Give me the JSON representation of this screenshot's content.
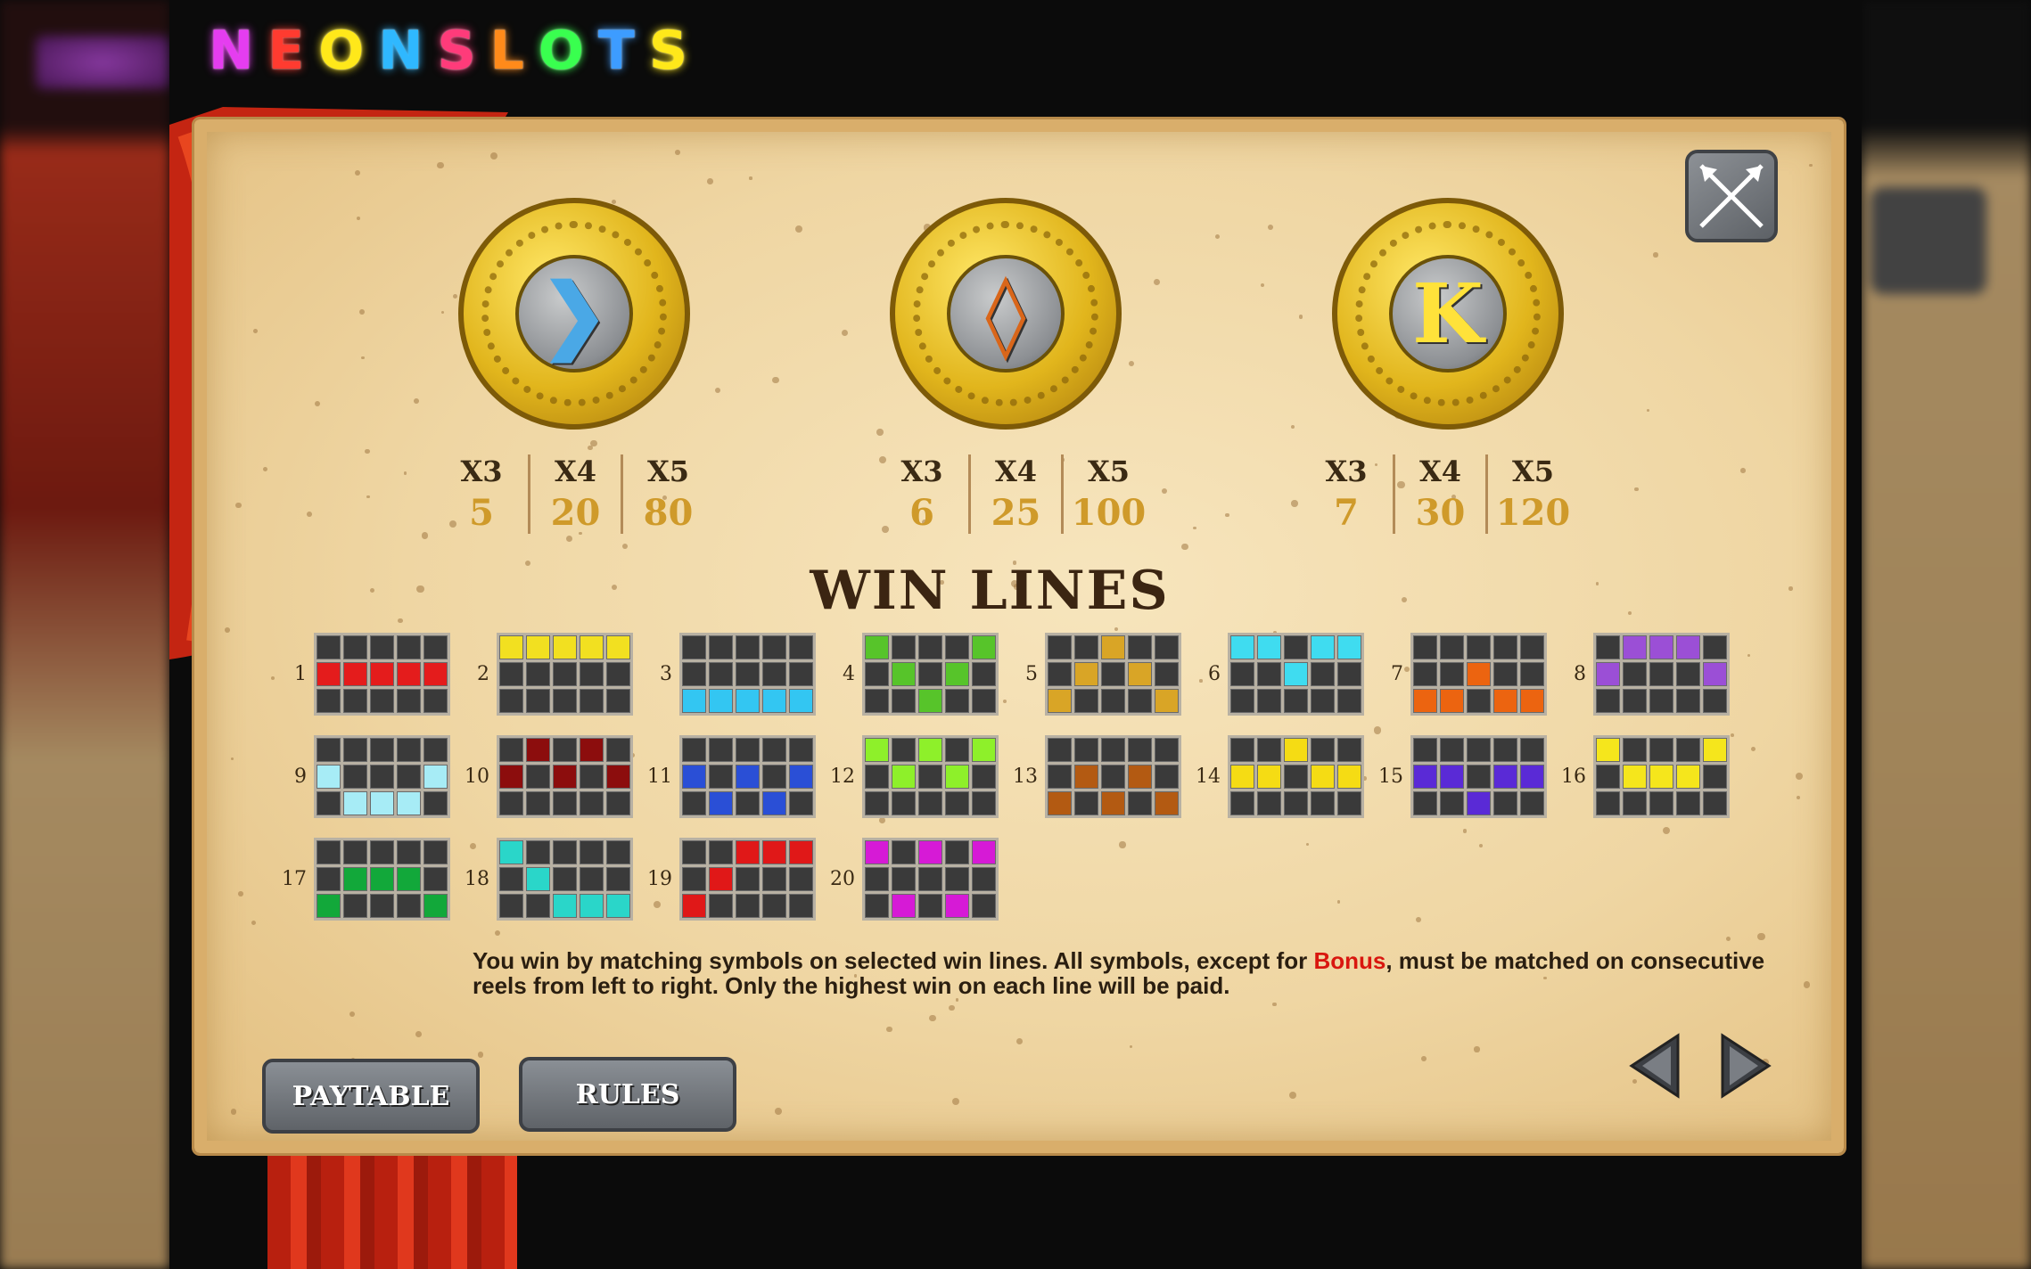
{
  "logo": {
    "letters": [
      "N",
      "E",
      "O",
      "N",
      "S",
      "L",
      "O",
      "T",
      "S"
    ],
    "colors": [
      "#e53df0",
      "#ff3b30",
      "#ffe81a",
      "#2fb8ff",
      "#ff3b7a",
      "#ff8a1a",
      "#39ff4f",
      "#3d9cff",
      "#ffe81a"
    ]
  },
  "symbols": [
    {
      "icon": "rune-arrow-icon",
      "glyph": "❯",
      "glyph_color": "#4aa8e6",
      "payouts": [
        {
          "mult": "X3",
          "value": "5"
        },
        {
          "mult": "X4",
          "value": "20"
        },
        {
          "mult": "X5",
          "value": "80"
        }
      ]
    },
    {
      "icon": "rune-diamond-icon",
      "glyph": "◊",
      "glyph_color": "#d9661a",
      "payouts": [
        {
          "mult": "X3",
          "value": "6"
        },
        {
          "mult": "X4",
          "value": "25"
        },
        {
          "mult": "X5",
          "value": "100"
        }
      ]
    },
    {
      "icon": "rune-k-icon",
      "glyph": "K",
      "glyph_color": "#ffe23a",
      "payouts": [
        {
          "mult": "X3",
          "value": "7"
        },
        {
          "mult": "X4",
          "value": "30"
        },
        {
          "mult": "X5",
          "value": "120"
        }
      ]
    }
  ],
  "win_lines_title": "WIN LINES",
  "win_lines": [
    {
      "num": "1",
      "color": "#e41c1c",
      "rows": [
        1,
        1,
        1,
        1,
        1
      ]
    },
    {
      "num": "2",
      "color": "#f2e020",
      "rows": [
        0,
        0,
        0,
        0,
        0
      ]
    },
    {
      "num": "3",
      "color": "#33c6f2",
      "rows": [
        2,
        2,
        2,
        2,
        2
      ]
    },
    {
      "num": "4",
      "color": "#57c42a",
      "rows": [
        0,
        1,
        2,
        1,
        0
      ]
    },
    {
      "num": "5",
      "color": "#d9a526",
      "rows": [
        2,
        1,
        0,
        1,
        2
      ]
    },
    {
      "num": "6",
      "color": "#3fdcf0",
      "rows": [
        0,
        0,
        1,
        0,
        0
      ]
    },
    {
      "num": "7",
      "color": "#ec6410",
      "rows": [
        2,
        2,
        1,
        2,
        2
      ]
    },
    {
      "num": "8",
      "color": "#9b4fd6",
      "rows": [
        1,
        0,
        0,
        0,
        1
      ]
    },
    {
      "num": "9",
      "color": "#a7ecf6",
      "rows": [
        1,
        2,
        2,
        2,
        1
      ]
    },
    {
      "num": "10",
      "color": "#8c0d0d",
      "rows": [
        1,
        0,
        1,
        0,
        1
      ]
    },
    {
      "num": "11",
      "color": "#2a4fd6",
      "rows": [
        1,
        2,
        1,
        2,
        1
      ]
    },
    {
      "num": "12",
      "color": "#8ef02a",
      "rows": [
        0,
        1,
        0,
        1,
        0
      ]
    },
    {
      "num": "13",
      "color": "#b35a12",
      "rows": [
        2,
        1,
        2,
        1,
        2
      ]
    },
    {
      "num": "14",
      "color": "#f5dc14",
      "rows": [
        1,
        1,
        0,
        1,
        1
      ]
    },
    {
      "num": "15",
      "color": "#5a2ad6",
      "rows": [
        1,
        1,
        2,
        1,
        1
      ]
    },
    {
      "num": "16",
      "color": "#f5e61c",
      "rows": [
        0,
        1,
        1,
        1,
        0
      ]
    },
    {
      "num": "17",
      "color": "#12a83a",
      "rows": [
        2,
        1,
        1,
        1,
        2
      ]
    },
    {
      "num": "18",
      "color": "#2ad6c9",
      "rows": [
        0,
        1,
        2,
        2,
        2
      ]
    },
    {
      "num": "19",
      "color": "#e01818",
      "rows": [
        2,
        1,
        0,
        0,
        0
      ]
    },
    {
      "num": "20",
      "color": "#d61ad6",
      "rows": [
        0,
        2,
        0,
        2,
        0
      ]
    }
  ],
  "description": {
    "before": "You win by matching symbols on selected win lines. All symbols, except for ",
    "bonus": "Bonus",
    "after": ", must be matched on consecutive reels from left to right. Only the highest win on each line will be paid."
  },
  "buttons": {
    "paytable": "PAYTABLE",
    "rules": "RULES"
  },
  "icons": {
    "close": "crossed-arrows-icon",
    "prev": "arrow-left-icon",
    "next": "arrow-right-icon"
  }
}
